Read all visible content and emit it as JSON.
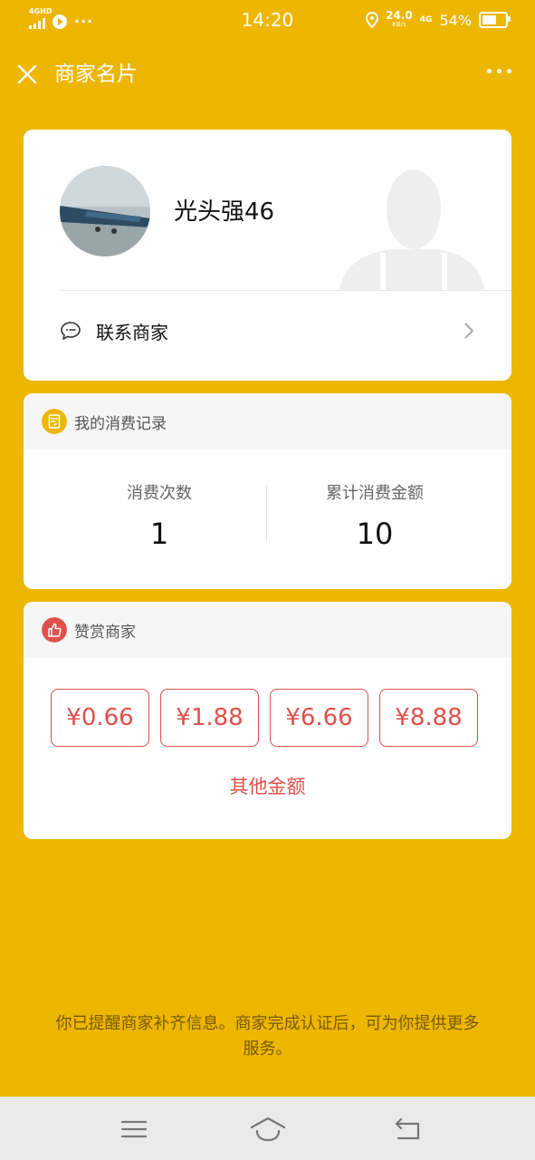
{
  "status_bar": {
    "network_label": "4GHD",
    "time": "14:20",
    "speed_value": "24.0",
    "speed_unit": "KB/s",
    "network_type": "4G",
    "battery": "54%",
    "battery_fraction": 0.54
  },
  "header": {
    "title": "商家名片"
  },
  "profile": {
    "merchant_name": "光头强46",
    "contact_label": "联系商家"
  },
  "consumption": {
    "section_title": "我的消费记录",
    "stats": [
      {
        "label": "消费次数",
        "value": "1"
      },
      {
        "label": "累计消费金额",
        "value": "10"
      }
    ]
  },
  "tip": {
    "section_title": "赞赏商家",
    "amounts": [
      "¥0.66",
      "¥1.88",
      "¥6.66",
      "¥8.88"
    ],
    "other_label": "其他金额"
  },
  "footer": {
    "note": "你已提醒商家补齐信息。商家完成认证后，可为你提供更多服务。"
  },
  "colors": {
    "background": "#EDB600",
    "accent_red": "#E0504A",
    "card": "#FFFFFF"
  }
}
